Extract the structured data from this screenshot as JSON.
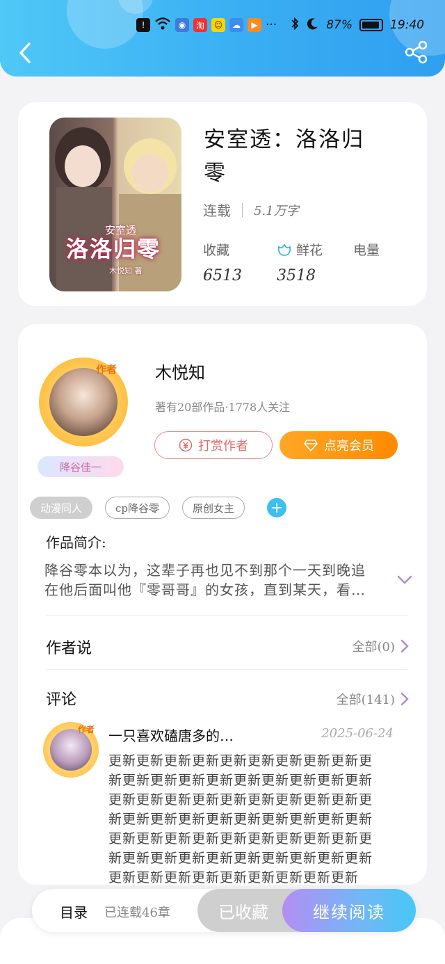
{
  "status_bar": {
    "battery_percent": "87%",
    "time": "19:40",
    "more": "···"
  },
  "book": {
    "title": "安室透：洛洛归零",
    "cover_title": "洛洛归零",
    "cover_subtitle": "安室透",
    "cover_author": "木悦知 著",
    "status": "连载",
    "word_count": "5.1万字",
    "stats": [
      {
        "label": "收藏",
        "value": "6513"
      },
      {
        "label": "鲜花",
        "value": "3518"
      },
      {
        "label": "电量",
        "value": ""
      }
    ]
  },
  "author": {
    "badge": "作者",
    "name": "木悦知",
    "info": "著有20部作品·1778人关注",
    "tag": "降谷佳一",
    "reward_label": "打赏作者",
    "member_label": "点亮会员"
  },
  "tags": [
    "动漫同人",
    "cp降谷零",
    "原创女主"
  ],
  "intro": {
    "label": "作品简介:",
    "text": "降谷零本以为，这辈子再也见不到那个一天到晚追在他后面叫他『零哥哥』的女孩，直到某天，看…"
  },
  "author_says": {
    "title": "作者说",
    "link": "全部(0)"
  },
  "comments": {
    "title": "评论",
    "link": "全部(141)",
    "items": [
      {
        "badge": "作者",
        "user": "一只喜欢磕唐多的…",
        "date": "2025-06-24",
        "text": "更新更新更新更新更新更新更新更新更新更新更新更新更新更新更新更新更新更新更新更新更新更新更新更新更新更新更新更新更新更新更新更新更新更新更新更新更新更新更新更新更新更新更新更新更新更新更新更新更新更新更新更新更新更新更新更新更新更新更新更新更新更新更新更新更新更新"
      }
    ]
  },
  "bottom_bar": {
    "toc_label": "目录",
    "toc_status": "已连载46章",
    "collected_label": "已收藏",
    "continue_label": "继续阅读"
  },
  "colors": {
    "header": "#3aaef3",
    "accent_orange": "#ff8a00",
    "accent_blue": "#3cc0f0"
  }
}
